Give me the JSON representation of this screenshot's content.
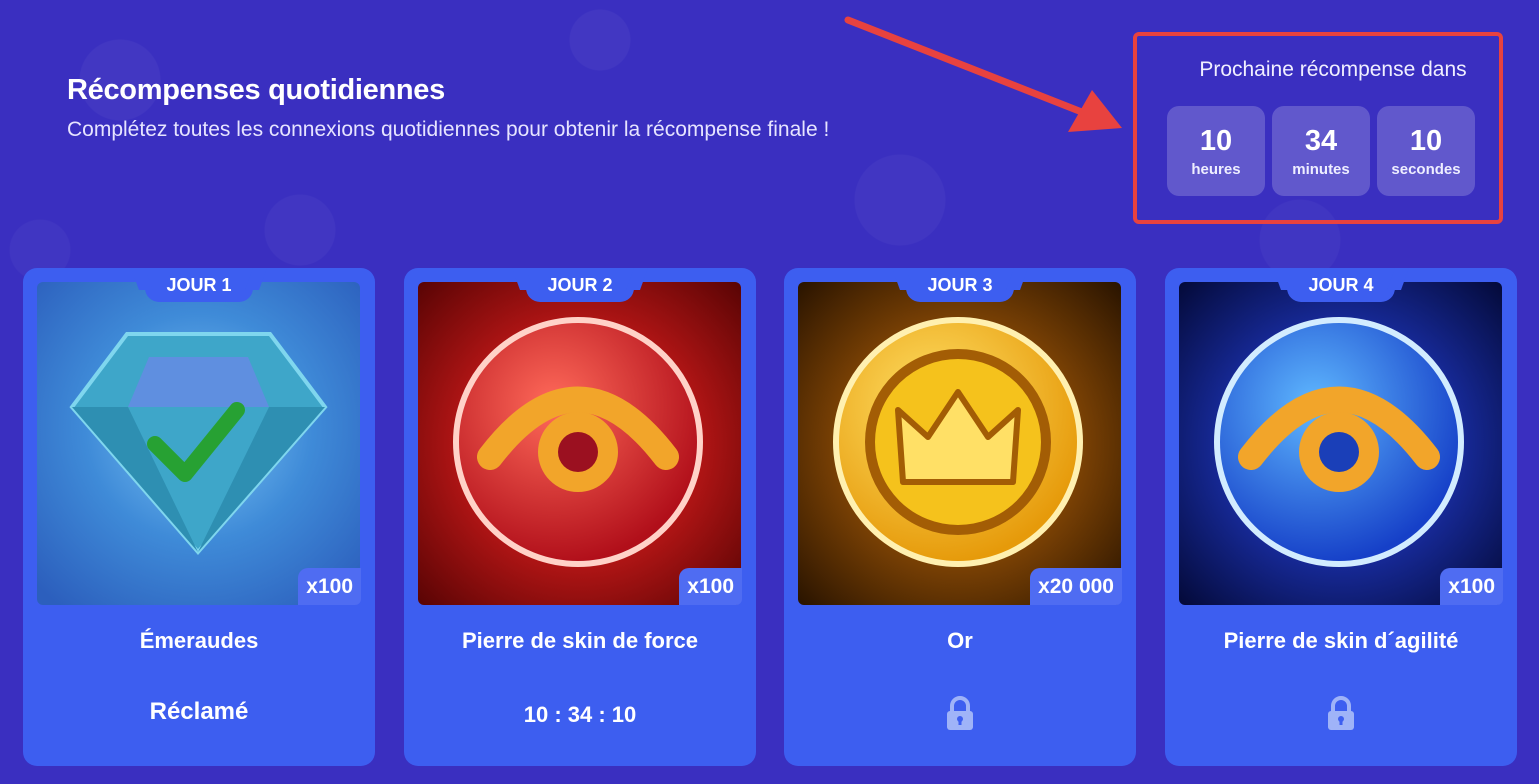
{
  "header": {
    "title": "Récompenses quotidiennes",
    "subtitle": "Complétez toutes les connexions quotidiennes pour obtenir la récompense finale !"
  },
  "timer": {
    "label": "Prochaine récompense dans",
    "units": [
      {
        "value": "10",
        "name": "heures"
      },
      {
        "value": "34",
        "name": "minutes"
      },
      {
        "value": "10",
        "name": "secondes"
      }
    ]
  },
  "cards": [
    {
      "day": "JOUR 1",
      "quantity": "x100",
      "name": "Émeraudes",
      "status": "Réclamé",
      "icon": "emerald-gem-checked-icon"
    },
    {
      "day": "JOUR 2",
      "quantity": "x100",
      "name": "Pierre de skin de force",
      "status": "10 : 34 : 10",
      "icon": "red-force-stone-icon"
    },
    {
      "day": "JOUR 3",
      "quantity": "x20 000",
      "name": "Or",
      "status_icon": "lock-icon",
      "icon": "gold-crown-coin-icon"
    },
    {
      "day": "JOUR 4",
      "quantity": "x100",
      "name": "Pierre de skin d´agilité",
      "status_icon": "lock-icon",
      "icon": "blue-agility-stone-icon"
    }
  ],
  "colors": {
    "background": "#3a2fc0",
    "card": "#3d5ef0",
    "annotation": "#e8423f"
  }
}
